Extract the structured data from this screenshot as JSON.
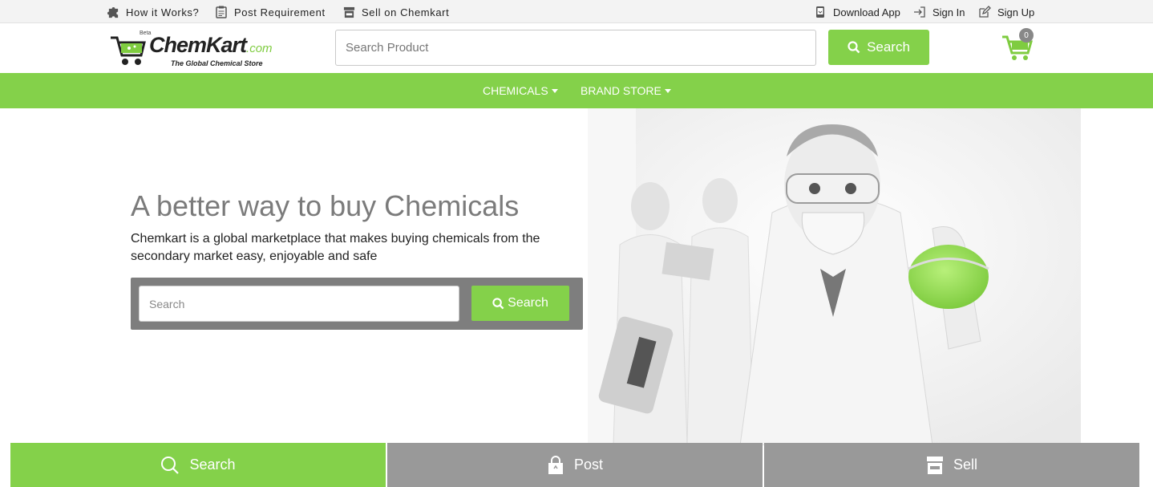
{
  "topbar": {
    "left": [
      {
        "label": "How it Works?",
        "icon": "puzzle-icon"
      },
      {
        "label": "Post Requirement",
        "icon": "clipboard-icon"
      },
      {
        "label": "Sell on Chemkart",
        "icon": "store-icon"
      }
    ],
    "right": [
      {
        "label": "Download App",
        "icon": "phone-download-icon"
      },
      {
        "label": "Sign In",
        "icon": "sign-in-icon"
      },
      {
        "label": "Sign Up",
        "icon": "edit-icon"
      }
    ]
  },
  "header": {
    "logo": {
      "beta": "Beta",
      "name_part1": "Chem",
      "name_part2": "Kart",
      "domain": ".com",
      "tagline": "The Global Chemical Store"
    },
    "search_placeholder": "Search Product",
    "search_button": "Search",
    "cart_count": "0"
  },
  "nav": {
    "items": [
      {
        "label": "CHEMICALS"
      },
      {
        "label": "BRAND STORE"
      }
    ]
  },
  "hero": {
    "title": "A better way to buy Chemicals",
    "subtitle": "Chemkart is a global marketplace that makes buying chemicals from the secondary market easy, enjoyable and safe",
    "search_placeholder": "Search",
    "search_button": "Search"
  },
  "bottom_tabs": [
    {
      "label": "Search",
      "icon": "search-icon",
      "color": "#84d14a"
    },
    {
      "label": "Post",
      "icon": "bag-icon",
      "color": "#999999"
    },
    {
      "label": "Sell",
      "icon": "store-icon",
      "color": "#999999"
    }
  ],
  "colors": {
    "accent": "#84d14a",
    "gray": "#999999",
    "box": "#7e7e7e"
  }
}
